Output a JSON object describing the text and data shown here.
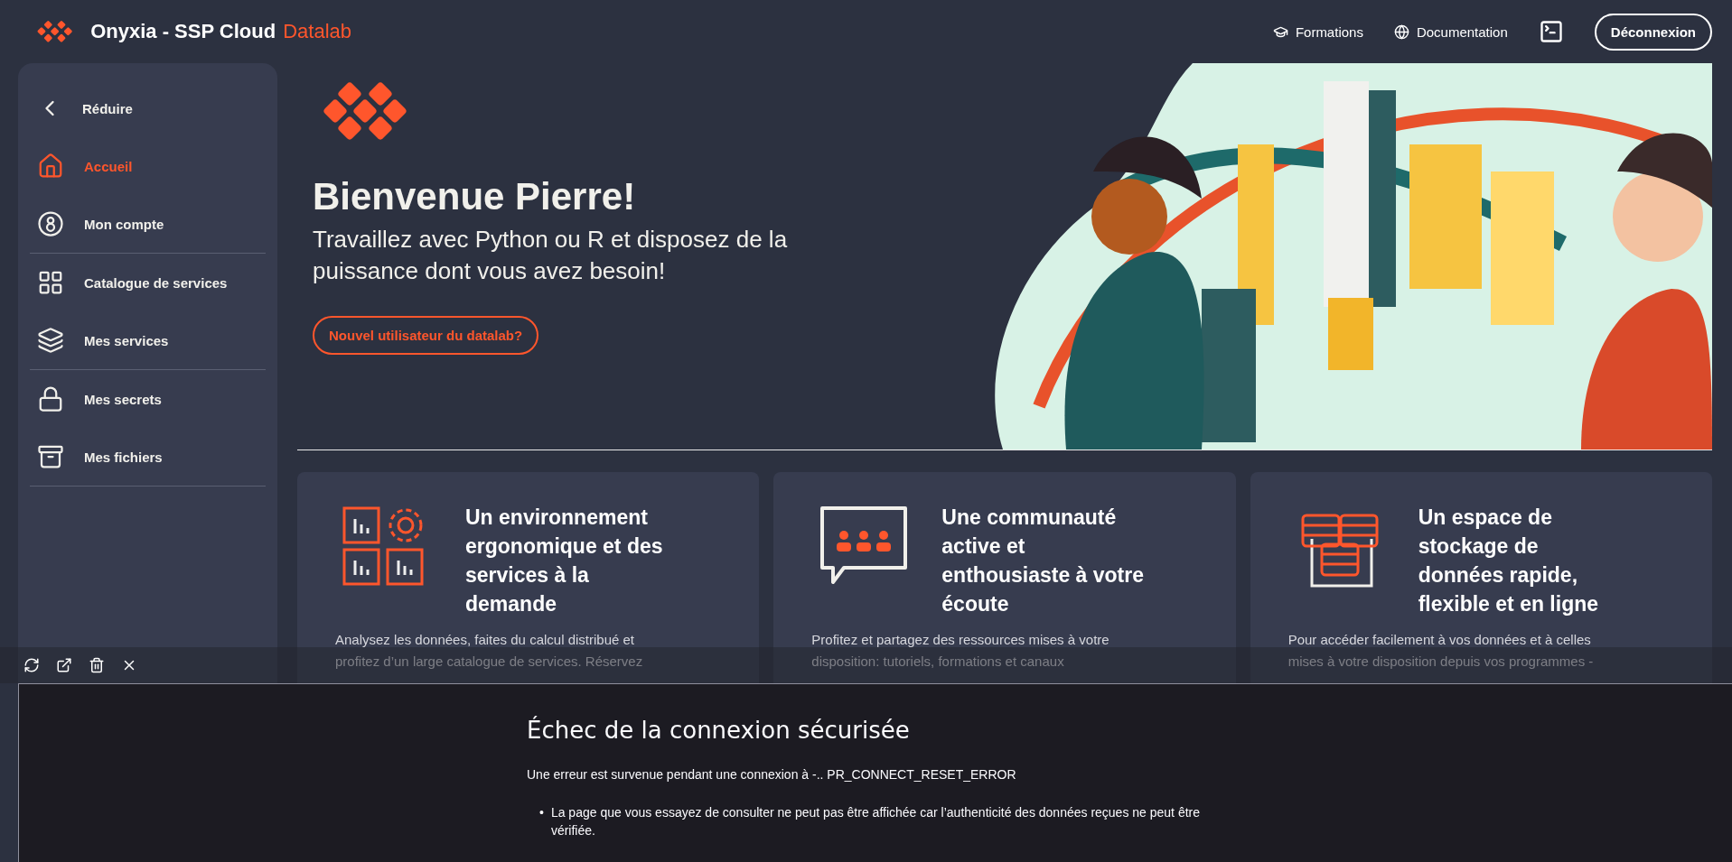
{
  "header": {
    "brand": "Onyxia - SSP Cloud",
    "brand_accent": "Datalab",
    "links": [
      "Formations",
      "Documentation"
    ],
    "logout": "Déconnexion"
  },
  "sidebar": {
    "collapse": "Réduire",
    "sections": [
      [
        {
          "label": "Accueil",
          "selected": true
        },
        {
          "label": "Mon compte",
          "selected": false
        }
      ],
      [
        {
          "label": "Catalogue de services",
          "selected": false
        },
        {
          "label": "Mes services",
          "selected": false
        }
      ],
      [
        {
          "label": "Mes secrets",
          "selected": false
        },
        {
          "label": "Mes fichiers",
          "selected": false
        }
      ]
    ]
  },
  "hero": {
    "title": "Bienvenue Pierre!",
    "subtitle": "Travaillez avec Python ou R et disposez de la puissance dont vous avez besoin!",
    "button": "Nouvel utilisateur du datalab?"
  },
  "cards": [
    {
      "title": "Un environnement ergonomique et des services à la demande",
      "description": [
        "Analysez les données, faites du calcul distribué et",
        "profitez d’un large catalogue de services. Réservez"
      ]
    },
    {
      "title": "Une communauté active et enthousiaste à votre écoute",
      "description": [
        "Profitez et partagez des ressources mises à votre",
        "disposition: tutoriels, formations et canaux"
      ]
    },
    {
      "title": "Un espace de stockage de données rapide, flexible et en ligne",
      "description": [
        "Pour accéder facilement à vos données et à celles",
        "mises à votre disposition depuis vos programmes -"
      ]
    }
  ],
  "error_panel": {
    "title": "Échec de la connexion sécurisée",
    "message": "Une erreur est survenue pendant une connexion à -.. PR_CONNECT_RESET_ERROR",
    "bullet_marker": "•",
    "bullets": [
      "La page que vous essayez de consulter ne peut pas être affichée car l’authenticité des données reçues ne peut être vérifiée."
    ]
  }
}
